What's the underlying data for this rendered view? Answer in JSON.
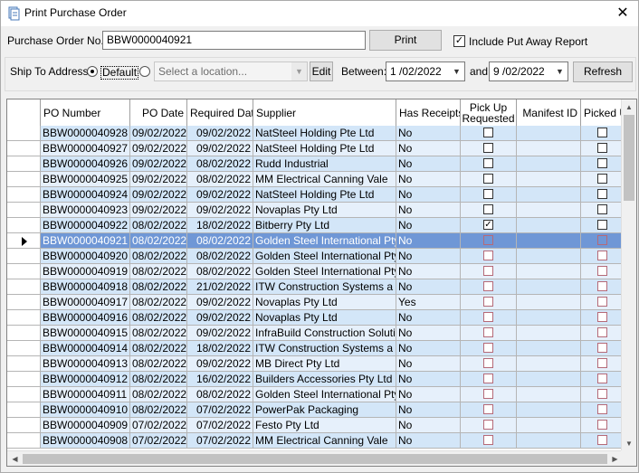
{
  "window": {
    "title": "Print Purchase Order",
    "close_glyph": "✕"
  },
  "form": {
    "po_label": "Purchase Order No.:",
    "po_value": "BBW0000040921",
    "print_label": "Print",
    "include_putaway_label": "Include Put Away Report",
    "include_putaway_checked": true,
    "ship_to_label": "Ship To Address:",
    "default_label": "Default",
    "location_placeholder": "Select a location...",
    "edit_label": "Edit",
    "between_label": "Between:",
    "date_from": "1 /02/2022",
    "and_label": "and",
    "date_to": "9 /02/2022",
    "refresh_label": "Refresh"
  },
  "grid": {
    "columns": [
      "PO Number",
      "PO Date",
      "Required Date",
      "Supplier",
      "Has Receipts",
      "Pick Up Requested",
      "Manifest ID",
      "Picked U"
    ],
    "selected_index": 7,
    "rows": [
      {
        "po": "BBW0000040928",
        "po_date": "09/02/2022",
        "req_date": "09/02/2022",
        "supplier": "NatSteel Holding Pte Ltd",
        "receipts": "No",
        "pickup": false
      },
      {
        "po": "BBW0000040927",
        "po_date": "09/02/2022",
        "req_date": "09/02/2022",
        "supplier": "NatSteel Holding Pte Ltd",
        "receipts": "No",
        "pickup": false
      },
      {
        "po": "BBW0000040926",
        "po_date": "09/02/2022",
        "req_date": "08/02/2022",
        "supplier": "Rudd Industrial",
        "receipts": "No",
        "pickup": false
      },
      {
        "po": "BBW0000040925",
        "po_date": "09/02/2022",
        "req_date": "08/02/2022",
        "supplier": "MM Electrical Canning Vale",
        "receipts": "No",
        "pickup": false
      },
      {
        "po": "BBW0000040924",
        "po_date": "09/02/2022",
        "req_date": "09/02/2022",
        "supplier": "NatSteel Holding Pte Ltd",
        "receipts": "No",
        "pickup": false
      },
      {
        "po": "BBW0000040923",
        "po_date": "09/02/2022",
        "req_date": "09/02/2022",
        "supplier": "Novaplas Pty Ltd",
        "receipts": "No",
        "pickup": false
      },
      {
        "po": "BBW0000040922",
        "po_date": "08/02/2022",
        "req_date": "18/02/2022",
        "supplier": "Bitberry Pty Ltd",
        "receipts": "No",
        "pickup": true
      },
      {
        "po": "BBW0000040921",
        "po_date": "08/02/2022",
        "req_date": "08/02/2022",
        "supplier": "Golden Steel International Pty Ltd",
        "receipts": "No",
        "pickup": false
      },
      {
        "po": "BBW0000040920",
        "po_date": "08/02/2022",
        "req_date": "08/02/2022",
        "supplier": "Golden Steel International Pty Ltd",
        "receipts": "No",
        "pickup": false
      },
      {
        "po": "BBW0000040919",
        "po_date": "08/02/2022",
        "req_date": "08/02/2022",
        "supplier": "Golden Steel International Pty Ltd",
        "receipts": "No",
        "pickup": false
      },
      {
        "po": "BBW0000040918",
        "po_date": "08/02/2022",
        "req_date": "21/02/2022",
        "supplier": "ITW Construction Systems a Div",
        "receipts": "No",
        "pickup": false
      },
      {
        "po": "BBW0000040917",
        "po_date": "08/02/2022",
        "req_date": "09/02/2022",
        "supplier": "Novaplas Pty Ltd",
        "receipts": "Yes",
        "pickup": false
      },
      {
        "po": "BBW0000040916",
        "po_date": "08/02/2022",
        "req_date": "09/02/2022",
        "supplier": "Novaplas Pty Ltd",
        "receipts": "No",
        "pickup": false
      },
      {
        "po": "BBW0000040915",
        "po_date": "08/02/2022",
        "req_date": "09/02/2022",
        "supplier": "InfraBuild Construction Solutions",
        "receipts": "No",
        "pickup": false
      },
      {
        "po": "BBW0000040914",
        "po_date": "08/02/2022",
        "req_date": "18/02/2022",
        "supplier": "ITW Construction Systems a Div",
        "receipts": "No",
        "pickup": false
      },
      {
        "po": "BBW0000040913",
        "po_date": "08/02/2022",
        "req_date": "09/02/2022",
        "supplier": "MB Direct Pty Ltd",
        "receipts": "No",
        "pickup": false
      },
      {
        "po": "BBW0000040912",
        "po_date": "08/02/2022",
        "req_date": "16/02/2022",
        "supplier": "Builders Accessories Pty Ltd NT",
        "receipts": "No",
        "pickup": false
      },
      {
        "po": "BBW0000040911",
        "po_date": "08/02/2022",
        "req_date": "08/02/2022",
        "supplier": "Golden Steel International Pty Ltd",
        "receipts": "No",
        "pickup": false
      },
      {
        "po": "BBW0000040910",
        "po_date": "08/02/2022",
        "req_date": "07/02/2022",
        "supplier": "PowerPak Packaging",
        "receipts": "No",
        "pickup": false
      },
      {
        "po": "BBW0000040909",
        "po_date": "07/02/2022",
        "req_date": "07/02/2022",
        "supplier": "Festo Pty Ltd",
        "receipts": "No",
        "pickup": false
      },
      {
        "po": "BBW0000040908",
        "po_date": "07/02/2022",
        "req_date": "07/02/2022",
        "supplier": "MM Electrical Canning Vale",
        "receipts": "No",
        "pickup": false
      }
    ]
  },
  "icons": {
    "title": "print-icon",
    "close": "close-icon",
    "check": "✓",
    "dropdown": "▼",
    "up": "▲",
    "down": "▼",
    "left": "◀",
    "right": "▶"
  },
  "colors": {
    "row_alt": "#d3e6f8",
    "row_plain": "#e6f0fb",
    "row_selected": "#6f97d6"
  }
}
